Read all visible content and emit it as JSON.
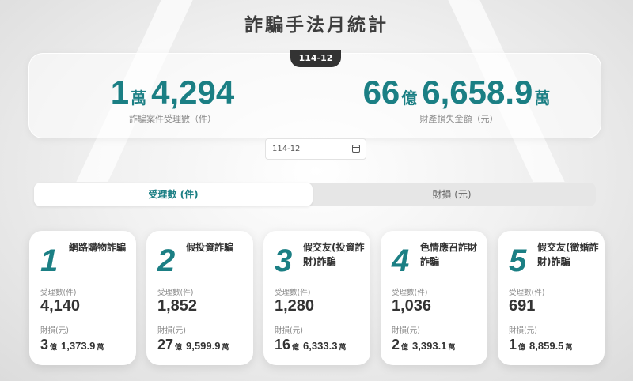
{
  "title": "詐騙手法月統計",
  "month_badge": "114-12",
  "summary": {
    "cases": {
      "num1": "1",
      "unit1": "萬",
      "num2": "4,294",
      "label": "詐騙案件受理數（件）"
    },
    "loss": {
      "num1": "66",
      "unit1": "億",
      "num2": "6,658.9",
      "unit2": "萬",
      "label": "財產損失金額（元）"
    }
  },
  "date_input": {
    "value": "114-12",
    "icon": "calendar-icon"
  },
  "tabs": [
    {
      "label": "受理數 (件)",
      "active": true
    },
    {
      "label": "財損 (元)",
      "active": false
    }
  ],
  "cards": [
    {
      "rank": "1",
      "name": "網路購物詐騙",
      "count_label": "受理數(件)",
      "count": "4,140",
      "loss_label": "財損(元)",
      "loss_yi": "3",
      "loss_yi_unit": "億",
      "loss_wan": "1,373.9",
      "loss_wan_unit": "萬"
    },
    {
      "rank": "2",
      "name": "假投資詐騙",
      "count_label": "受理數(件)",
      "count": "1,852",
      "loss_label": "財損(元)",
      "loss_yi": "27",
      "loss_yi_unit": "億",
      "loss_wan": "9,599.9",
      "loss_wan_unit": "萬"
    },
    {
      "rank": "3",
      "name": "假交友(投資詐財)詐騙",
      "count_label": "受理數(件)",
      "count": "1,280",
      "loss_label": "財損(元)",
      "loss_yi": "16",
      "loss_yi_unit": "億",
      "loss_wan": "6,333.3",
      "loss_wan_unit": "萬"
    },
    {
      "rank": "4",
      "name": "色情應召詐財詐騙",
      "count_label": "受理數(件)",
      "count": "1,036",
      "loss_label": "財損(元)",
      "loss_yi": "2",
      "loss_yi_unit": "億",
      "loss_wan": "3,393.1",
      "loss_wan_unit": "萬"
    },
    {
      "rank": "5",
      "name": "假交友(徵婚詐財)詐騙",
      "count_label": "受理數(件)",
      "count": "691",
      "loss_label": "財損(元)",
      "loss_yi": "1",
      "loss_yi_unit": "億",
      "loss_wan": "8,859.5",
      "loss_wan_unit": "萬"
    }
  ],
  "colors": {
    "accent": "#1b7f84",
    "badge": "#333333"
  }
}
